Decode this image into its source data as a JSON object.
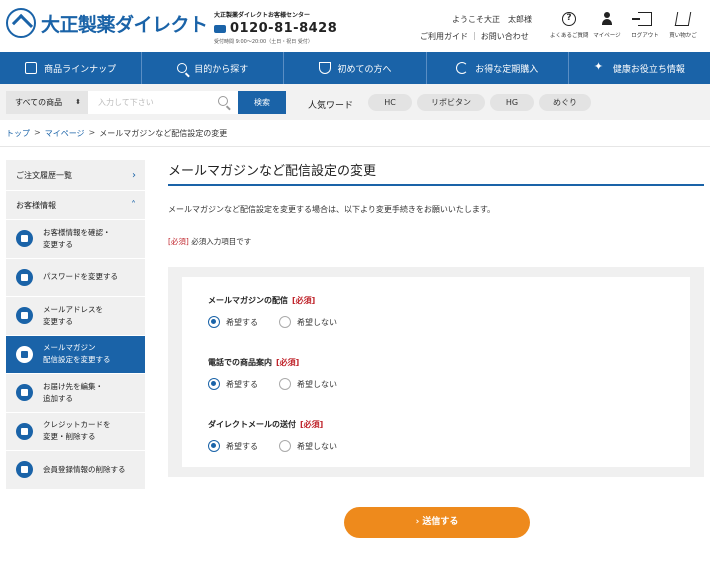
{
  "header": {
    "logo_text": "大正製薬ダイレクト",
    "callcenter_label": "大正製薬ダイレクトお客様センター",
    "phone": "0120-81-8428",
    "hours": "受付時間 9:00〜20:00（土日・祝日 受付）",
    "welcome": "ようこそ大正　太郎様",
    "guide": "ご利用ガイド",
    "contact": "お問い合わせ",
    "icons": [
      {
        "label": "よくあるご質問",
        "icon": "faq-icon"
      },
      {
        "label": "マイページ",
        "icon": "person-icon"
      },
      {
        "label": "ログアウト",
        "icon": "logout-icon"
      },
      {
        "label": "買い物かご",
        "icon": "cart-icon"
      }
    ]
  },
  "gnav": [
    {
      "label": "商品ラインナップ",
      "icon": "products-icon"
    },
    {
      "label": "目的から探す",
      "icon": "search-icon"
    },
    {
      "label": "初めての方へ",
      "icon": "shield-icon"
    },
    {
      "label": "お得な定期購入",
      "icon": "cycle-icon"
    },
    {
      "label": "健康お役立ち情報",
      "icon": "sparkle-icon"
    }
  ],
  "search": {
    "category": "すべての商品",
    "placeholder": "入力して下さい",
    "button": "検索",
    "keyword_label": "人気ワード",
    "keywords": [
      "HC",
      "リポビタン",
      "HG",
      "めぐり"
    ]
  },
  "breadcrumb": {
    "top": "トップ",
    "mypage": "マイページ",
    "current": "メールマガジンなど配信設定の変更",
    "sep": ">"
  },
  "sidebar": {
    "order_history": "ご注文履歴一覧",
    "customer_info": "お客様情報",
    "items": [
      {
        "line1": "お客様情報を確認・",
        "line2": "変更する"
      },
      {
        "line1": "パスワードを変更する",
        "line2": ""
      },
      {
        "line1": "メールアドレスを",
        "line2": "変更する"
      },
      {
        "line1": "メールマガジン",
        "line2": "配信設定を変更する"
      },
      {
        "line1": "お届け先を編集・",
        "line2": "追加する"
      },
      {
        "line1": "クレジットカードを",
        "line2": "変更・削除する"
      },
      {
        "line1": "会員登録情報の削除する",
        "line2": ""
      }
    ]
  },
  "main": {
    "title": "メールマガジンなど配信設定の変更",
    "description": "メールマガジンなど配信設定を変更する場合は、以下より変更手続きをお願いいたします。",
    "required_tag": "[必須]",
    "required_note": "必須入力項目です",
    "fields": [
      {
        "label": "メールマガジンの配信",
        "required": "[必須]",
        "option_yes": "希望する",
        "option_no": "希望しない",
        "selected": "希望する"
      },
      {
        "label": "電話での商品案内",
        "required": "[必須]",
        "option_yes": "希望する",
        "option_no": "希望しない",
        "selected": "希望する"
      },
      {
        "label": "ダイレクトメールの送付",
        "required": "[必須]",
        "option_yes": "希望する",
        "option_no": "希望しない",
        "selected": "希望する"
      }
    ],
    "submit": "› 送信する"
  },
  "colors": {
    "brand_blue": "#1a63a8",
    "submit_orange": "#ee8a1c",
    "required_red": "#c0262d"
  }
}
